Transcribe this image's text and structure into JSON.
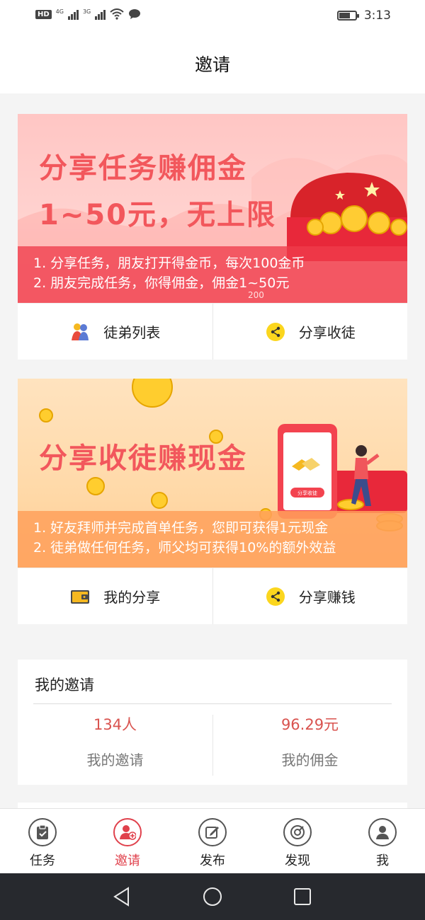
{
  "status_bar": {
    "hd": "HD",
    "net1": "4G",
    "net2": "3G",
    "time": "3:13"
  },
  "header": {
    "title": "邀请"
  },
  "card1": {
    "title_line1": "分享任务赚佣金",
    "title_line2": "1~50元，无上限",
    "rule1": "1. 分享任务，朋友打开得金币，每次100金币",
    "rule2": "2. 朋友完成任务，你得佣金，佣金1~50元",
    "coin_label": "200",
    "action_left": {
      "label": "徒弟列表",
      "icon": "disciples-icon"
    },
    "action_right": {
      "label": "分享收徒",
      "icon": "share-icon"
    }
  },
  "card2": {
    "title": "分享收徒赚现金",
    "phone_label": "分享收徒",
    "rule1": "1. 好友拜师并完成首单任务，您即可获得1元现金",
    "rule2": "2. 徒弟做任何任务，师父均可获得10%的额外效益",
    "action_left": {
      "label": "我的分享",
      "icon": "wallet-icon"
    },
    "action_right": {
      "label": "分享赚钱",
      "icon": "share-icon"
    }
  },
  "invites": {
    "title": "我的邀请",
    "count_value": "134人",
    "count_label": "我的邀请",
    "commission_value": "96.29元",
    "commission_label": "我的佣金"
  },
  "tabbar": {
    "items": [
      {
        "label": "任务",
        "icon": "clipboard-icon",
        "active": false
      },
      {
        "label": "邀请",
        "icon": "add-user-icon",
        "active": true
      },
      {
        "label": "发布",
        "icon": "edit-icon",
        "active": false
      },
      {
        "label": "发现",
        "icon": "compass-icon",
        "active": false
      },
      {
        "label": "我",
        "icon": "user-icon",
        "active": false
      }
    ]
  },
  "colors": {
    "accent": "#e0414c",
    "value_red": "#d9534f",
    "banner1_title": "#f2575c",
    "nav_bar": "#27292e"
  }
}
